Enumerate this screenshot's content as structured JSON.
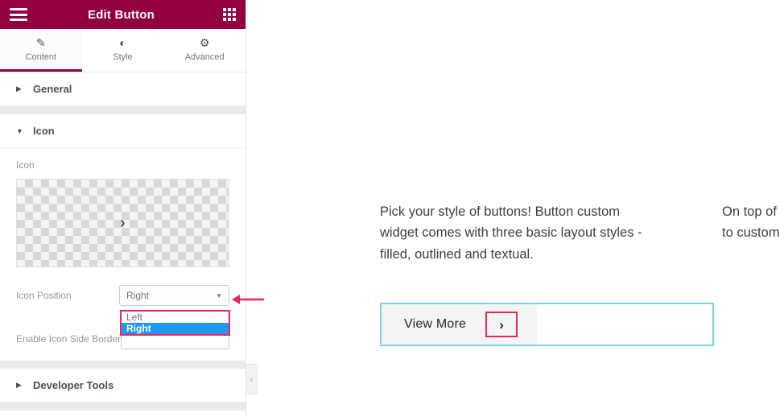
{
  "panel": {
    "header": {
      "title": "Edit Button",
      "menu_icon": "hamburger-icon",
      "apps_icon": "grid-apps-icon"
    },
    "tabs": [
      {
        "label": "Content",
        "icon": "pencil-icon",
        "active": true
      },
      {
        "label": "Style",
        "icon": "contrast-icon",
        "active": false
      },
      {
        "label": "Advanced",
        "icon": "gear-icon",
        "active": false
      }
    ],
    "sections": [
      {
        "title": "General",
        "caret": "▶",
        "expanded": false
      },
      {
        "title": "Icon",
        "caret": "▼",
        "expanded": true
      },
      {
        "title": "Developer Tools",
        "caret": "▶",
        "expanded": false
      }
    ],
    "icon_field": {
      "label": "Icon",
      "preview_glyph": "›",
      "preview_icon_name": "chevron-right-icon"
    },
    "icon_position": {
      "label": "Icon Position",
      "value": "Right",
      "caret": "▼",
      "options": [
        "Left",
        "Right"
      ],
      "selected_option": "Right"
    },
    "icon_side_border": {
      "label": "Enable Icon Side Border"
    },
    "collapse_handle_glyph": "‹"
  },
  "canvas": {
    "columns": [
      {
        "text": "Pick your style of buttons! Button custom widget comes with three basic layout styles - filled, outlined and textual."
      },
      {
        "text": "On top of that, you also get to customize standard"
      }
    ],
    "button": {
      "label": "View More",
      "icon_glyph": "›",
      "icon_name": "chevron-right-icon"
    }
  },
  "colors": {
    "header_bg": "#93003f",
    "accent_red": "#e8275a",
    "dropdown_highlight": "#2196f3",
    "button_outline": "#76d4ec"
  }
}
